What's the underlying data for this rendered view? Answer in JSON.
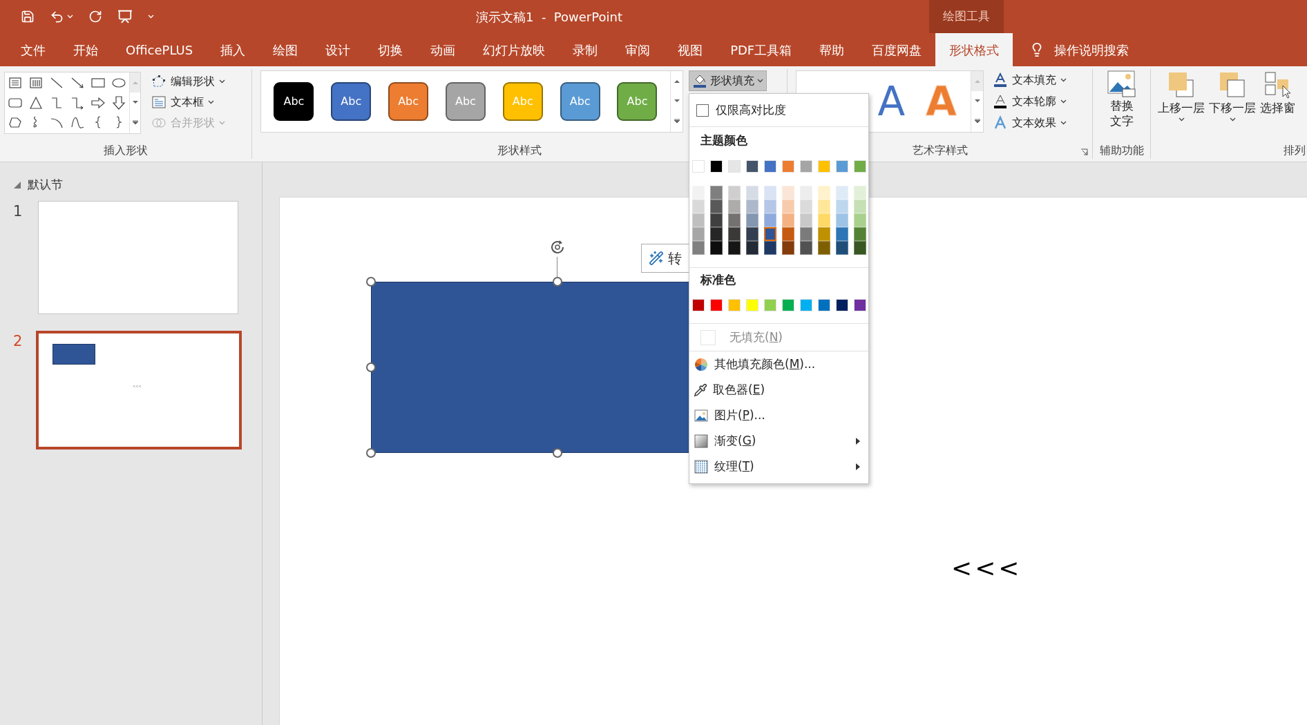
{
  "window": {
    "title": "演示文稿1  -  PowerPoint",
    "context_group": "绘图工具"
  },
  "tabs": [
    {
      "label": "文件",
      "selected": false
    },
    {
      "label": "开始",
      "selected": false
    },
    {
      "label": "OfficePLUS",
      "selected": false
    },
    {
      "label": "插入",
      "selected": false
    },
    {
      "label": "绘图",
      "selected": false
    },
    {
      "label": "设计",
      "selected": false
    },
    {
      "label": "切换",
      "selected": false
    },
    {
      "label": "动画",
      "selected": false
    },
    {
      "label": "幻灯片放映",
      "selected": false
    },
    {
      "label": "录制",
      "selected": false
    },
    {
      "label": "审阅",
      "selected": false
    },
    {
      "label": "视图",
      "selected": false
    },
    {
      "label": "PDF工具箱",
      "selected": false
    },
    {
      "label": "帮助",
      "selected": false
    },
    {
      "label": "百度网盘",
      "selected": false
    },
    {
      "label": "形状格式",
      "selected": true
    }
  ],
  "tell_me": {
    "label": "操作说明搜索"
  },
  "ribbon": {
    "insert_shapes": {
      "label": "插入形状",
      "commands": [
        {
          "kind": "edit-shape",
          "label": "编辑形状",
          "dropdown": true,
          "disabled": false
        },
        {
          "kind": "text-box",
          "label": "文本框",
          "dropdown": true,
          "disabled": false
        },
        {
          "kind": "merge-shapes",
          "label": "合并形状",
          "dropdown": true,
          "disabled": true
        }
      ]
    },
    "shape_styles": {
      "label": "形状样式",
      "presets": [
        {
          "label": "Abc",
          "color": "#000000"
        },
        {
          "label": "Abc",
          "color": "#4472c4"
        },
        {
          "label": "Abc",
          "color": "#ed7d31"
        },
        {
          "label": "Abc",
          "color": "#a5a5a5"
        },
        {
          "label": "Abc",
          "color": "#ffc000"
        },
        {
          "label": "Abc",
          "color": "#5b9bd5"
        },
        {
          "label": "Abc",
          "color": "#70ad47"
        }
      ],
      "fill_button": {
        "label": "形状填充",
        "pressed": true
      }
    },
    "wordart_styles": {
      "label": "艺术字样式",
      "presets": [
        {
          "label": "A",
          "kind": "solid",
          "color": "#4472c4"
        },
        {
          "label": "A",
          "kind": "outline",
          "color": "#ed7d31"
        }
      ],
      "commands": [
        {
          "kind": "text-fill",
          "label": "文本填充"
        },
        {
          "kind": "text-outline",
          "label": "文本轮廓"
        },
        {
          "kind": "text-effects",
          "label": "文本效果"
        }
      ]
    },
    "accessibility": {
      "label": "辅助功能",
      "button_lines": [
        "替换",
        "文字"
      ]
    },
    "arrange": {
      "label": "排列",
      "commands": [
        {
          "kind": "bring-forward",
          "label": "上移一层",
          "dropdown": true
        },
        {
          "kind": "send-backward",
          "label": "下移一层",
          "dropdown": true
        },
        {
          "kind": "selection-pane",
          "label": "选择窗",
          "dropdown": false
        }
      ]
    }
  },
  "slide_panel": {
    "section": {
      "label": "默认节",
      "expanded": true
    },
    "slides": [
      {
        "number": "1",
        "selected": false,
        "has_shape": false
      },
      {
        "number": "2",
        "selected": true,
        "has_shape": true,
        "text": "<<<"
      }
    ]
  },
  "canvas": {
    "shape_selected": true,
    "convert_button": {
      "label": "转"
    },
    "text": "<<<"
  },
  "menu": {
    "high_contrast_only": {
      "label": "仅限高对比度",
      "checked": false
    },
    "theme_heading": "主题颜色",
    "theme_colors": [
      {
        "color": "#ffffff",
        "selected": false,
        "shades": [
          {
            "color": "#f2f2f2",
            "selected": false
          },
          {
            "color": "#d9d9d9",
            "selected": false
          },
          {
            "color": "#bfbfbf",
            "selected": false
          },
          {
            "color": "#a6a6a6",
            "selected": false
          },
          {
            "color": "#808080",
            "selected": false
          }
        ]
      },
      {
        "color": "#000000",
        "selected": false,
        "shades": [
          {
            "color": "#7f7f7f",
            "selected": false
          },
          {
            "color": "#595959",
            "selected": false
          },
          {
            "color": "#3f3f3f",
            "selected": false
          },
          {
            "color": "#262626",
            "selected": false
          },
          {
            "color": "#0d0d0d",
            "selected": false
          }
        ]
      },
      {
        "color": "#e7e6e6",
        "selected": false,
        "shades": [
          {
            "color": "#d0cece",
            "selected": false
          },
          {
            "color": "#aeabab",
            "selected": false
          },
          {
            "color": "#757171",
            "selected": false
          },
          {
            "color": "#3b3838",
            "selected": false
          },
          {
            "color": "#171616",
            "selected": false
          }
        ]
      },
      {
        "color": "#44546a",
        "selected": false,
        "shades": [
          {
            "color": "#d6dce5",
            "selected": false
          },
          {
            "color": "#adb9ca",
            "selected": false
          },
          {
            "color": "#8497b0",
            "selected": false
          },
          {
            "color": "#333f50",
            "selected": false
          },
          {
            "color": "#222a35",
            "selected": false
          }
        ]
      },
      {
        "color": "#4472c4",
        "selected": false,
        "shades": [
          {
            "color": "#dae3f3",
            "selected": false
          },
          {
            "color": "#b4c7e7",
            "selected": false
          },
          {
            "color": "#8faadc",
            "selected": false
          },
          {
            "color": "#2f5597",
            "selected": true
          },
          {
            "color": "#203864",
            "selected": false
          }
        ]
      },
      {
        "color": "#ed7d31",
        "selected": false,
        "shades": [
          {
            "color": "#fbe5d6",
            "selected": false
          },
          {
            "color": "#f8cbad",
            "selected": false
          },
          {
            "color": "#f4b183",
            "selected": false
          },
          {
            "color": "#c55a11",
            "selected": false
          },
          {
            "color": "#843c0c",
            "selected": false
          }
        ]
      },
      {
        "color": "#a5a5a5",
        "selected": false,
        "shades": [
          {
            "color": "#ededed",
            "selected": false
          },
          {
            "color": "#dbdbdb",
            "selected": false
          },
          {
            "color": "#c9c9c9",
            "selected": false
          },
          {
            "color": "#7b7b7b",
            "selected": false
          },
          {
            "color": "#525252",
            "selected": false
          }
        ]
      },
      {
        "color": "#ffc000",
        "selected": false,
        "shades": [
          {
            "color": "#fff2cc",
            "selected": false
          },
          {
            "color": "#ffe699",
            "selected": false
          },
          {
            "color": "#ffd966",
            "selected": false
          },
          {
            "color": "#bf9000",
            "selected": false
          },
          {
            "color": "#7f6000",
            "selected": false
          }
        ]
      },
      {
        "color": "#5b9bd5",
        "selected": false,
        "shades": [
          {
            "color": "#deebf7",
            "selected": false
          },
          {
            "color": "#bdd7ee",
            "selected": false
          },
          {
            "color": "#9dc3e6",
            "selected": false
          },
          {
            "color": "#2e75b6",
            "selected": false
          },
          {
            "color": "#1f4e79",
            "selected": false
          }
        ]
      },
      {
        "color": "#70ad47",
        "selected": false,
        "shades": [
          {
            "color": "#e2f0d9",
            "selected": false
          },
          {
            "color": "#c5e0b4",
            "selected": false
          },
          {
            "color": "#a9d18e",
            "selected": false
          },
          {
            "color": "#548235",
            "selected": false
          },
          {
            "color": "#385723",
            "selected": false
          }
        ]
      }
    ],
    "standard_heading": "标准色",
    "standard_colors": [
      {
        "color": "#c00000",
        "selected": false
      },
      {
        "color": "#ff0000",
        "selected": false
      },
      {
        "color": "#ffc000",
        "selected": false
      },
      {
        "color": "#ffff00",
        "selected": false
      },
      {
        "color": "#92d050",
        "selected": false
      },
      {
        "color": "#00b050",
        "selected": false
      },
      {
        "color": "#00b0f0",
        "selected": false
      },
      {
        "color": "#0070c0",
        "selected": false
      },
      {
        "color": "#002060",
        "selected": false
      },
      {
        "color": "#7030a0",
        "selected": false
      }
    ],
    "items": [
      {
        "kind": "no-fill",
        "text": "无填充(",
        "access_key": "N",
        "suffix": ")",
        "disabled": true,
        "submenu": false
      },
      {
        "kind": "more-colors",
        "text": "其他填充颜色(",
        "access_key": "M",
        "suffix": ")...",
        "disabled": false,
        "submenu": false
      },
      {
        "kind": "eyedropper",
        "text": "取色器(",
        "access_key": "E",
        "suffix": ")",
        "disabled": false,
        "submenu": false
      },
      {
        "kind": "picture",
        "text": "图片(",
        "access_key": "P",
        "suffix": ")...",
        "disabled": false,
        "submenu": false
      },
      {
        "kind": "gradient",
        "text": "渐变(",
        "access_key": "G",
        "suffix": ")",
        "disabled": false,
        "submenu": true
      },
      {
        "kind": "texture",
        "text": "纹理(",
        "access_key": "T",
        "suffix": ")",
        "disabled": false,
        "submenu": true
      }
    ]
  }
}
